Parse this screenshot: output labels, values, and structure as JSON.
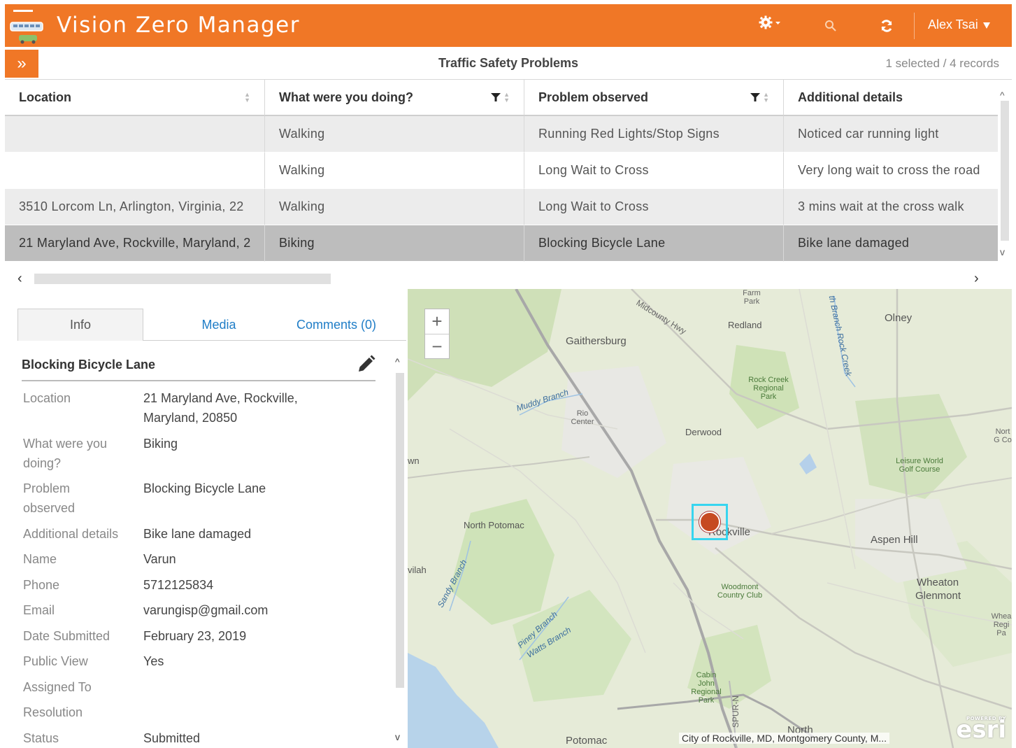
{
  "app": {
    "title": "Vision Zero Manager",
    "accent": "#f07726",
    "user": "Alex Tsai",
    "icons": [
      "bus-car-logo-icon",
      "gear-icon",
      "search-icon",
      "refresh-icon",
      "caret-down-icon"
    ]
  },
  "titlebar": {
    "expand_icon": "»",
    "layer_title": "Traffic Safety Problems",
    "record_count": "1 selected / 4 records"
  },
  "table": {
    "columns": [
      "Location",
      "What were you doing?",
      "Problem observed",
      "Additional details"
    ],
    "rows": [
      [
        "",
        "Walking",
        "Running Red Lights/Stop Signs",
        "Noticed car running light"
      ],
      [
        "",
        "Walking",
        "Long Wait to Cross",
        "Very long wait to cross the road"
      ],
      [
        "3510 Lorcom Ln, Arlington, Virginia, 22",
        "Walking",
        "Long Wait to Cross",
        "3 mins wait at the cross walk"
      ],
      [
        "21 Maryland Ave, Rockville, Maryland, 2",
        "Biking",
        "Blocking Bicycle Lane",
        "Bike lane damaged"
      ]
    ],
    "selected_row": 3,
    "scroll_left": "‹",
    "scroll_right": "›",
    "scroll_up": "^",
    "scroll_down": "v"
  },
  "detail": {
    "tabs": [
      "Info",
      "Media",
      "Comments (0)"
    ],
    "active_tab": "Info",
    "title": "Blocking Bicycle Lane",
    "fields": [
      {
        "label": "Location",
        "value": "21 Maryland Ave, Rockville, Maryland, 20850"
      },
      {
        "label": "What were you doing?",
        "value": "Biking"
      },
      {
        "label": "Problem observed",
        "value": "Blocking Bicycle Lane"
      },
      {
        "label": "Additional details",
        "value": "Bike lane damaged"
      },
      {
        "label": "Name",
        "value": "Varun"
      },
      {
        "label": "Phone",
        "value": "5712125834"
      },
      {
        "label": "Email",
        "value": "varungisp@gmail.com"
      },
      {
        "label": "Date Submitted",
        "value": "February 23, 2019"
      },
      {
        "label": "Public View",
        "value": "Yes"
      },
      {
        "label": "Assigned To",
        "value": ""
      },
      {
        "label": "Resolution",
        "value": ""
      },
      {
        "label": "Status",
        "value": "Submitted"
      }
    ]
  },
  "map": {
    "zoom_in": "+",
    "zoom_out": "−",
    "labels": {
      "gaithersburg": "Gaithersburg",
      "redland": "Redland",
      "olney": "Olney",
      "derwood": "Derwood",
      "north_potomac": "North Potomac",
      "rockville": "Rockville",
      "aspen_hill": "Aspen Hill",
      "wheaton": "Wheaton",
      "glenmont": "Glenmont",
      "potomac": "Potomac",
      "north": "North",
      "rock_creek": "Rock Creek Regional Park",
      "leisure_world": "Leisure World Golf Course",
      "woodmont": "Woodmont Country Club",
      "cabin_john": "Cabin John Regional Park",
      "rio_center": "Rio Center",
      "farm_park": "Farm Park",
      "muddy_branch": "Muddy Branch",
      "midcounty": "Midcounty Hwy",
      "sandy_branch": "Sandy Branch",
      "piney_branch": "Piney Branch",
      "watts_branch": "Watts Branch",
      "rock_creek_stream": "th Branch Rock Creek",
      "spur": "SPUR-N",
      "vilah": "vilah",
      "wn": "wn",
      "north_g_co": "Nort G Co",
      "whea_regi_pa": "Whea Regi Pa"
    },
    "attribution": "City of Rockville, MD, Montgomery County, M...",
    "powered_by": "POWERED BY",
    "logo_text": "esri"
  }
}
